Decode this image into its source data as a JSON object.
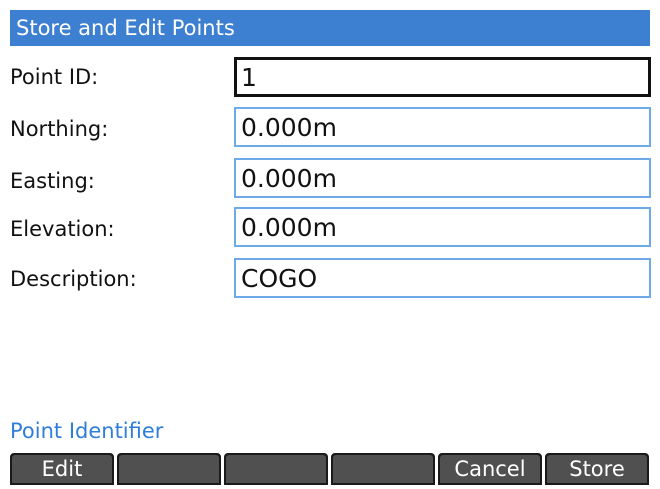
{
  "title": "Store and Edit Points",
  "fields": [
    {
      "label": "Point ID:",
      "value": "1",
      "focused": true
    },
    {
      "label": "Northing:",
      "value": "0.000m",
      "focused": false
    },
    {
      "label": "Easting:",
      "value": "0.000m",
      "focused": false
    },
    {
      "label": "Elevation:",
      "value": "0.000m",
      "focused": false
    },
    {
      "label": "Description:",
      "value": "COGO",
      "focused": false
    }
  ],
  "help_text": "Point Identifier",
  "softkeys": [
    "Edit",
    "",
    "",
    "",
    "Cancel",
    "Store"
  ],
  "colors": {
    "titlebar": "#3d7fd1",
    "field_border": "#6ea9e8",
    "help_text": "#2f7fd8",
    "softkey_bg": "#505050"
  }
}
